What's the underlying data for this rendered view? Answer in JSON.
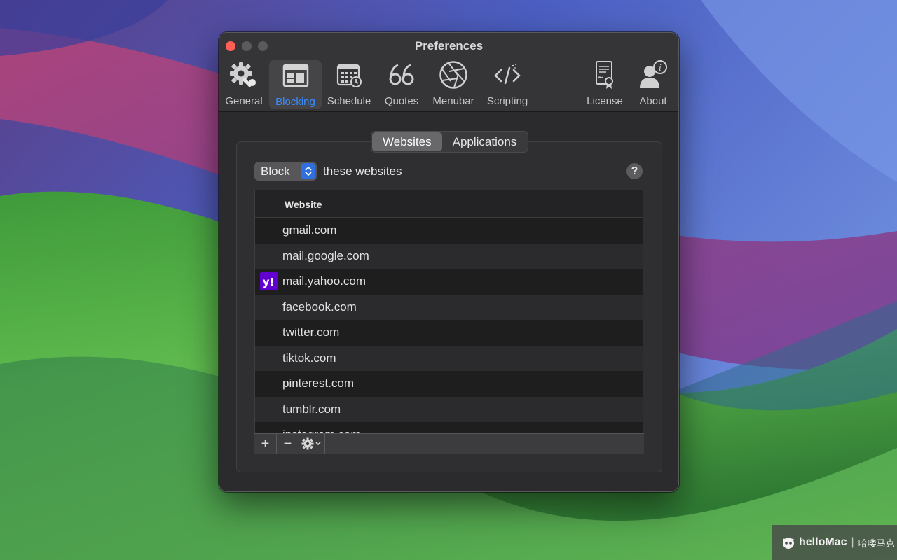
{
  "window": {
    "title": "Preferences"
  },
  "toolbar": {
    "items": [
      {
        "label": "General",
        "icon": "gear-icon"
      },
      {
        "label": "Blocking",
        "icon": "browser-window-icon",
        "selected": true
      },
      {
        "label": "Schedule",
        "icon": "calendar-icon"
      },
      {
        "label": "Quotes",
        "icon": "quote-icon"
      },
      {
        "label": "Menubar",
        "icon": "aperture-icon"
      },
      {
        "label": "Scripting",
        "icon": "code-icon"
      },
      {
        "label": "License",
        "icon": "certificate-icon"
      },
      {
        "label": "About",
        "icon": "person-info-icon"
      }
    ]
  },
  "tabs": {
    "websites": "Websites",
    "applications": "Applications",
    "active": "Websites"
  },
  "block_mode": {
    "value": "Block",
    "suffix": "these websites"
  },
  "help": {
    "label": "?"
  },
  "table": {
    "column": "Website",
    "rows": [
      {
        "site": "gmail.com",
        "icon": ""
      },
      {
        "site": "mail.google.com",
        "icon": ""
      },
      {
        "site": "mail.yahoo.com",
        "icon": "yahoo-icon",
        "icon_text": "y!"
      },
      {
        "site": "facebook.com",
        "icon": ""
      },
      {
        "site": "twitter.com",
        "icon": ""
      },
      {
        "site": "tiktok.com",
        "icon": ""
      },
      {
        "site": "pinterest.com",
        "icon": ""
      },
      {
        "site": "tumblr.com",
        "icon": ""
      },
      {
        "site": "instagram.com",
        "icon": ""
      }
    ]
  },
  "footer": {
    "add": "+",
    "remove": "−"
  },
  "watermark": {
    "brand": "helloMac",
    "cn": "哈喽马克"
  },
  "colors": {
    "accent": "#3a8dff",
    "close": "#ff5f57",
    "yahoo": "#6001d2"
  }
}
